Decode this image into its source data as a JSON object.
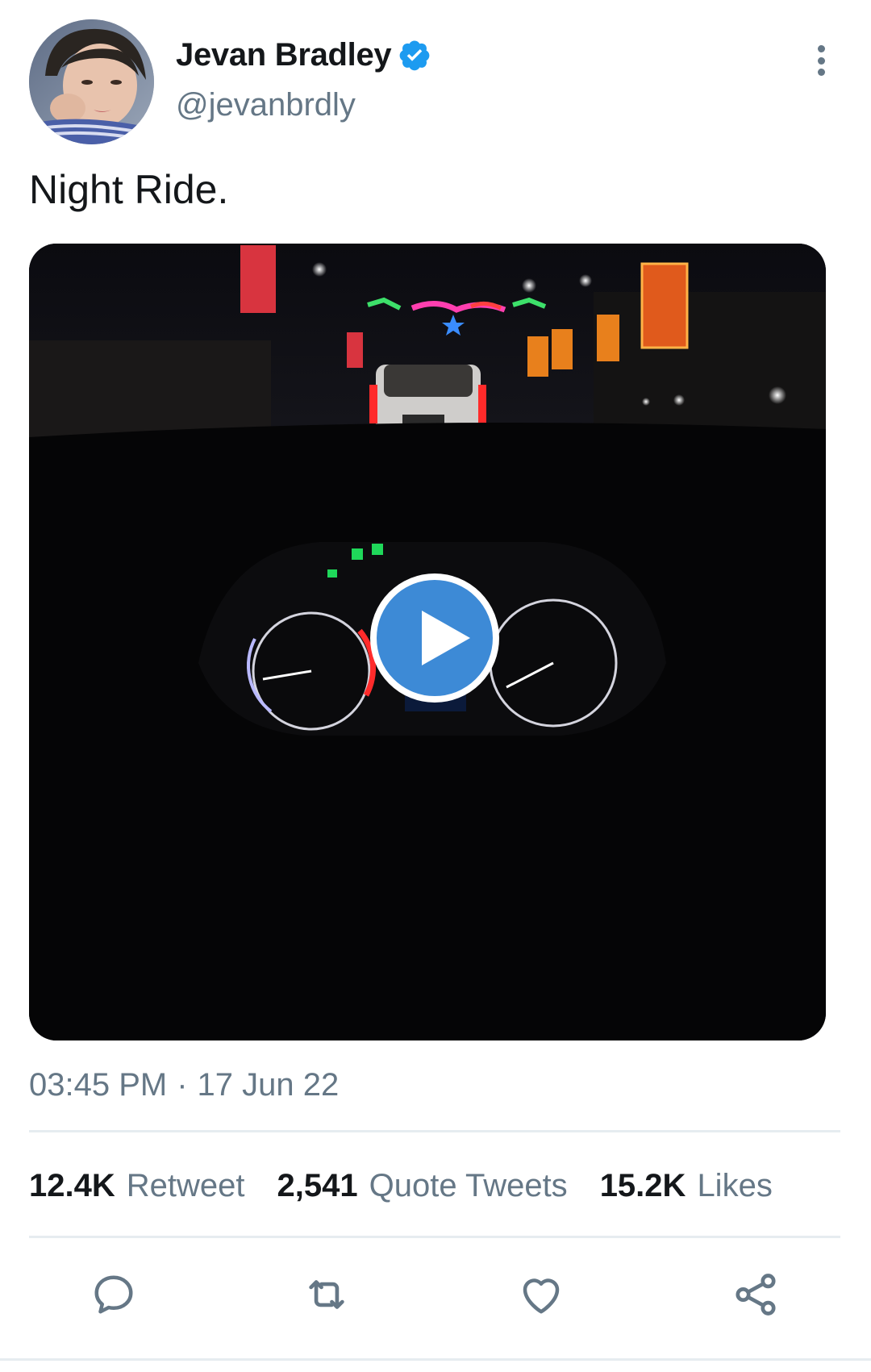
{
  "author": {
    "display_name": "Jevan Bradley",
    "handle": "@jevanbrdly",
    "verified": true,
    "avatar": "profile-photo"
  },
  "tweet": {
    "text": "Night Ride.",
    "media": {
      "type": "video",
      "play_icon": "play-icon",
      "thumbnail": "night car dashboard with speedometer and tachometer, street lights ahead"
    },
    "time": "03:45 PM",
    "separator": "·",
    "date": "17 Jun 22"
  },
  "stats": {
    "retweets": {
      "count": "12.4K",
      "label": "Retweet"
    },
    "quotes": {
      "count": "2,541",
      "label": "Quote Tweets"
    },
    "likes": {
      "count": "15.2K",
      "label": "Likes"
    }
  },
  "actions": [
    {
      "icon": "reply-icon"
    },
    {
      "icon": "retweet-icon"
    },
    {
      "icon": "like-icon"
    },
    {
      "icon": "share-icon"
    }
  ],
  "colors": {
    "text": "#14171a",
    "secondary": "#657786",
    "verified": "#1d9bf0",
    "play": "#3d8ad6",
    "divider": "#e6ecf0"
  }
}
